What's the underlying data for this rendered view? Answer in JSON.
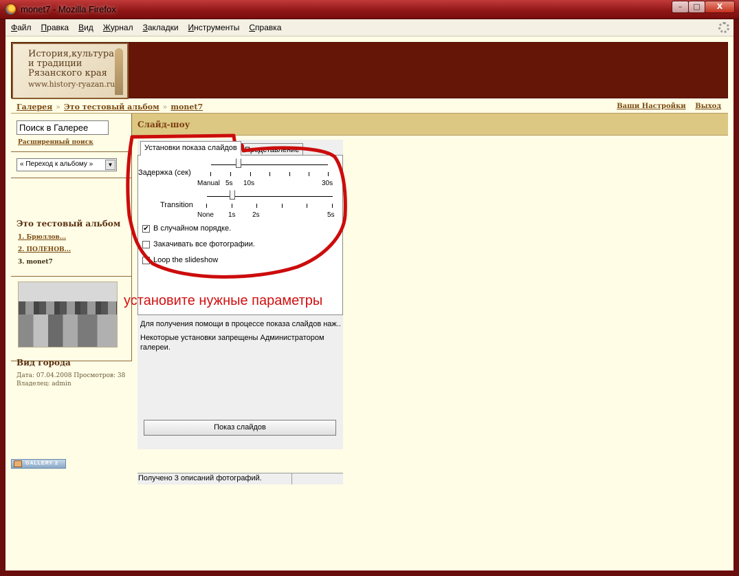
{
  "window": {
    "title": "monet7 - Mozilla Firefox",
    "min": "–",
    "max": "□",
    "close": "X"
  },
  "menu": [
    "Файл",
    "Правка",
    "Вид",
    "Журнал",
    "Закладки",
    "Инструменты",
    "Справка"
  ],
  "logo": {
    "line1": "История,культура и традиции Рязанского края",
    "line2": "www.history-ryazan.ru"
  },
  "breadcrumb": {
    "items": [
      "Галерея",
      "Это тестовый альбом",
      "monet7"
    ],
    "separator": "»"
  },
  "toplinks": {
    "settings": "Ваши Настройки",
    "logout": "Выход"
  },
  "sidebar": {
    "search_value": "Поиск в Галерее",
    "advanced_search": "Расширенный поиск",
    "jump_select": "« Переход к альбому »",
    "album_title": "Это тестовый альбом",
    "albums": [
      {
        "label": "1. Брюллов...",
        "link": true
      },
      {
        "label": "2. ПОЛЕНОВ...",
        "link": true
      },
      {
        "label": "3. monet7",
        "link": false
      }
    ],
    "photo_title": "Вид города",
    "photo_date": "Дата: 07.04.2008 Просмотров: 38",
    "photo_owner": "Владелец: admin"
  },
  "main": {
    "heading": "Слайд-шоу"
  },
  "applet": {
    "tabs": {
      "settings": "Установки показа слайдов",
      "view": "Представление"
    },
    "delay_label": "Задержка (сек)",
    "delay_ticks": [
      "Manual",
      "5s",
      "10s",
      "30s"
    ],
    "transition_label": "Transition",
    "transition_ticks": [
      "None",
      "1s",
      "2s",
      "5s"
    ],
    "options": [
      {
        "label": "В случайном порядке.",
        "checked": true
      },
      {
        "label": "Закачивать все фотографии.",
        "checked": false
      },
      {
        "label": "Loop the slideshow",
        "checked": false
      }
    ],
    "help_text": "Для получения помощи в процессе показа слайдов наж...",
    "restricted_text": "Некоторые установки запрещены Администратором галереи.",
    "show_button": "Показ слайдов",
    "status": "Получено 3 описаний фотографий."
  },
  "annotation": {
    "text": "установите нужные параметры",
    "color": "#d01010"
  },
  "footer_badge": "GALLERY 2",
  "colors": {
    "header_bg": "#661606",
    "page_bg": "#fffde6",
    "section_bg": "#dcc882",
    "link": "#7a4a12"
  }
}
